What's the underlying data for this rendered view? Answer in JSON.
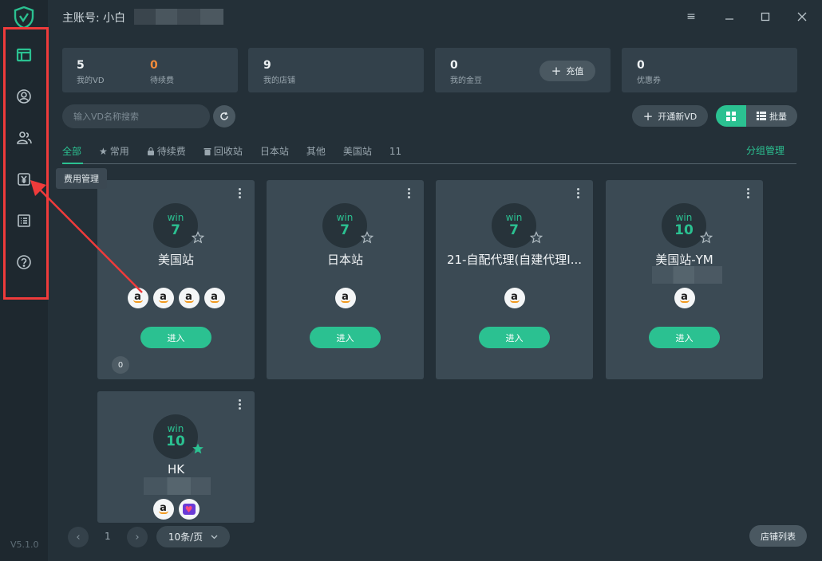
{
  "header": {
    "account_label": "主账号: 小白"
  },
  "window_controls": [
    "menu-icon",
    "minimize-icon",
    "maximize-icon",
    "close-icon"
  ],
  "sidebar": {
    "items": [
      {
        "name": "environment",
        "icon": "window-icon",
        "active": true
      },
      {
        "name": "account",
        "icon": "user-circle-icon"
      },
      {
        "name": "members",
        "icon": "team-icon"
      },
      {
        "name": "billing",
        "icon": "yen-icon"
      },
      {
        "name": "logs",
        "icon": "list-icon"
      },
      {
        "name": "help",
        "icon": "help-icon"
      }
    ],
    "tooltip": "费用管理",
    "version": "V5.1.0"
  },
  "stats": [
    {
      "value": "5",
      "label": "我的VD"
    },
    {
      "value": "0",
      "label": "待续费",
      "color": "#f28b3a"
    },
    {
      "value": "9",
      "label": "我的店铺"
    },
    {
      "value": "0",
      "label": "我的金豆"
    },
    {
      "value": "0",
      "label": "优惠券"
    }
  ],
  "recharge_label": "充值",
  "search": {
    "placeholder": "输入VD名称搜索"
  },
  "toolbar": {
    "new_vd_label": "开通新VD",
    "batch_label": "批量"
  },
  "tabs": [
    {
      "label": "全部",
      "active": true
    },
    {
      "label": "常用",
      "icon": "star-icon"
    },
    {
      "label": "待续费",
      "icon": "bag-icon"
    },
    {
      "label": "回收站",
      "icon": "trash-icon"
    },
    {
      "label": "日本站"
    },
    {
      "label": "其他"
    },
    {
      "label": "美国站"
    },
    {
      "label": "11"
    }
  ],
  "group_manage_label": "分组管理",
  "cards": [
    {
      "os": "win",
      "version": "7",
      "name": "美国站",
      "shops": [
        "amazon",
        "amazon",
        "amazon",
        "amazon"
      ],
      "enter": "进入",
      "count": "0",
      "favorite": false
    },
    {
      "os": "win",
      "version": "7",
      "name": "日本站",
      "shops": [
        "amazon"
      ],
      "enter": "进入",
      "favorite": false
    },
    {
      "os": "win",
      "version": "7",
      "name": "21-自配代理(自建代理I...",
      "shops": [
        "amazon"
      ],
      "enter": "进入",
      "favorite": false
    },
    {
      "os": "win",
      "version": "10",
      "name": "美国站-YM",
      "shops": [
        "amazon"
      ],
      "enter": "进入",
      "favorite": false
    },
    {
      "os": "win",
      "version": "10",
      "name": "HK",
      "shops": [
        "amazon",
        "heart-shop"
      ],
      "favorite": true
    }
  ],
  "pagination": {
    "current_page": "1",
    "page_size": "10条/页",
    "shop_list_label": "店铺列表"
  },
  "colors": {
    "accent": "#2bc191",
    "warning": "#f28b3a",
    "annotation": "#ef3b3b"
  }
}
